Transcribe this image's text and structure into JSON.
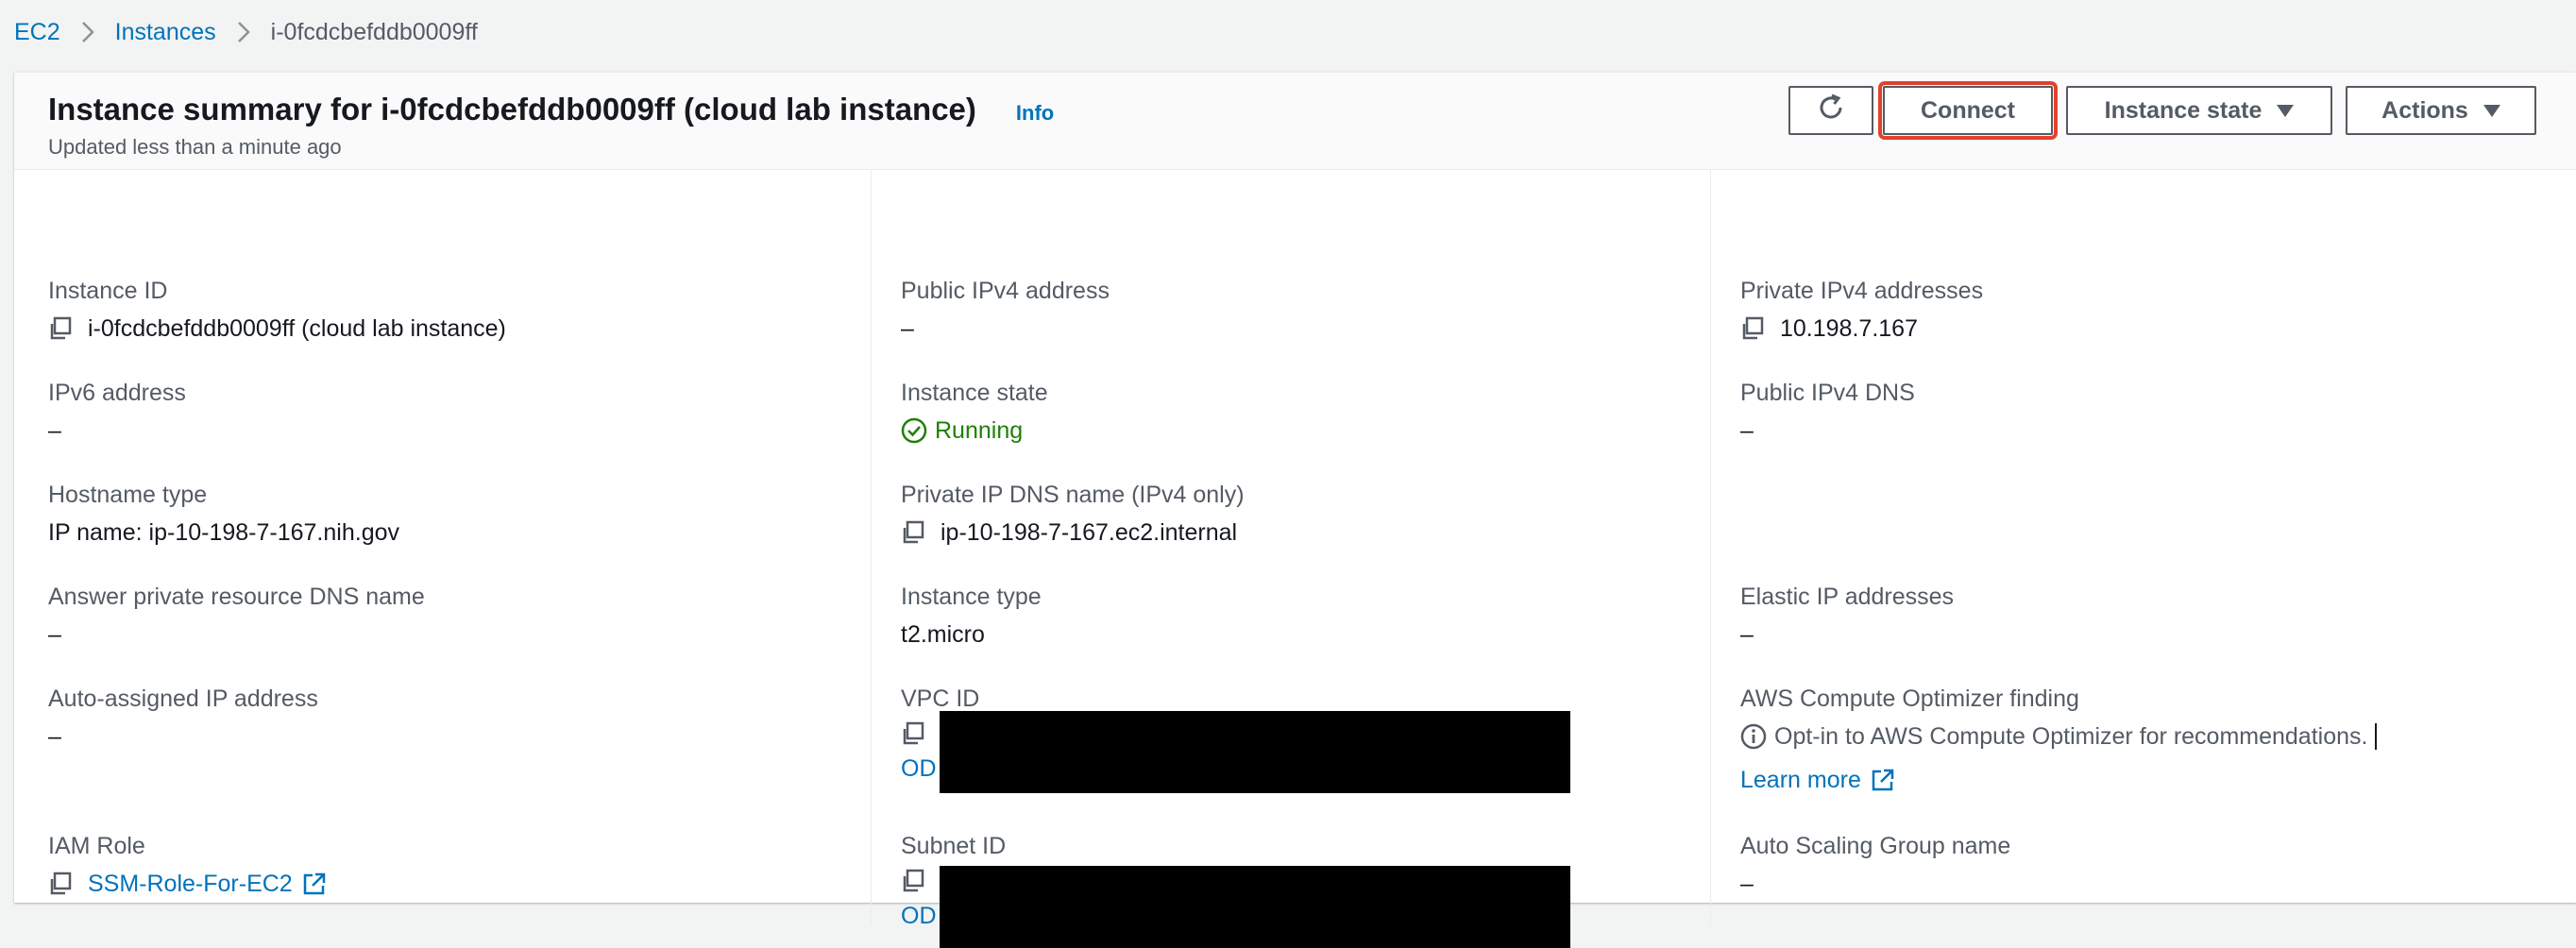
{
  "breadcrumb": {
    "items": [
      "EC2",
      "Instances"
    ],
    "current": "i-0fcdcbefddb0009ff"
  },
  "header": {
    "title": "Instance summary for i-0fcdcbefddb0009ff (cloud lab instance)",
    "info": "Info",
    "subtitle": "Updated less than a minute ago",
    "buttons": {
      "connect": "Connect",
      "instance_state": "Instance state",
      "actions": "Actions"
    }
  },
  "fields": {
    "instance_id": {
      "label": "Instance ID",
      "value": "i-0fcdcbefddb0009ff (cloud lab instance)"
    },
    "ipv6": {
      "label": "IPv6 address",
      "value": "–"
    },
    "hostname_type": {
      "label": "Hostname type",
      "value": "IP name: ip-10-198-7-167.nih.gov"
    },
    "answer_dns": {
      "label": "Answer private resource DNS name",
      "value": "–"
    },
    "auto_ip": {
      "label": "Auto-assigned IP address",
      "value": "–"
    },
    "iam_role": {
      "label": "IAM Role",
      "value": "SSM-Role-For-EC2"
    },
    "public_ipv4": {
      "label": "Public IPv4 address",
      "value": "–"
    },
    "instance_state": {
      "label": "Instance state",
      "value": "Running"
    },
    "private_dns": {
      "label": "Private IP DNS name (IPv4 only)",
      "value": "ip-10-198-7-167.ec2.internal"
    },
    "instance_type": {
      "label": "Instance type",
      "value": "t2.micro"
    },
    "vpc_id": {
      "label": "VPC ID",
      "value": "OD"
    },
    "subnet_id": {
      "label": "Subnet ID",
      "value": "OD"
    },
    "private_ipv4": {
      "label": "Private IPv4 addresses",
      "value": "10.198.7.167"
    },
    "public_dns": {
      "label": "Public IPv4 DNS",
      "value": "–"
    },
    "elastic_ip": {
      "label": "Elastic IP addresses",
      "value": "–"
    },
    "optimizer": {
      "label": "AWS Compute Optimizer finding",
      "value": "Opt-in to AWS Compute Optimizer for recommendations.",
      "link": "Learn more"
    },
    "asg": {
      "label": "Auto Scaling Group name",
      "value": "–"
    }
  },
  "colors": {
    "link": "#0073bb",
    "running": "#1d8102",
    "highlight": "#e2412f"
  },
  "icons": [
    "refresh-icon",
    "caret-down-icon",
    "copy-icon",
    "status-check-icon",
    "external-link-icon",
    "info-circle-icon",
    "chevron-right-icon"
  ]
}
